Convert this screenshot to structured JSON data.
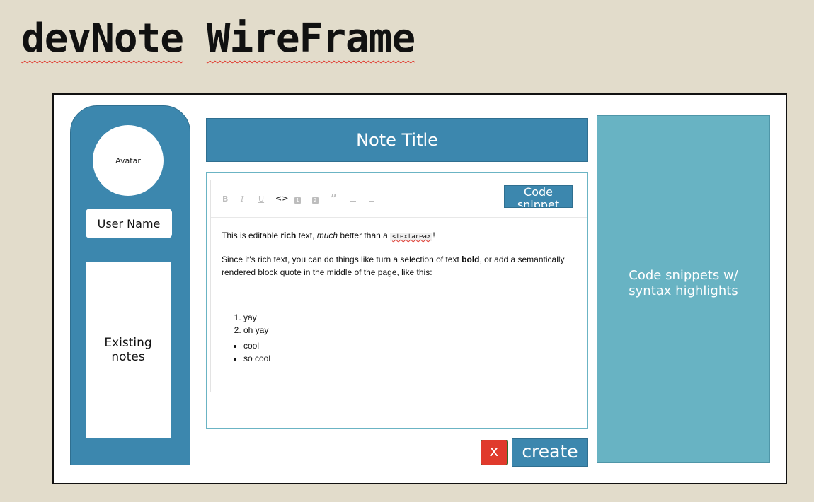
{
  "page": {
    "title_part1": "devNote",
    "title_part2": "WireFrame"
  },
  "sidebar": {
    "avatar_label": "Avatar",
    "username": "User Name",
    "notes_label": "Existing\nnotes"
  },
  "main": {
    "note_title": "Note Title",
    "code_snippet_button": "Code snippet",
    "toolbar": {
      "bold": "B",
      "italic": "I",
      "underline": "U",
      "code": "<>",
      "heading1": "1",
      "heading2": "2",
      "quote": "”"
    },
    "editor": {
      "p1_a": "This is editable ",
      "p1_b": "rich",
      "p1_c": " text, ",
      "p1_d": "much",
      "p1_e": " better than a ",
      "p1_code": "<textarea>",
      "p1_f": "!",
      "p2_a": "Since it's rich text, you can do things like turn a selection of text ",
      "p2_b": "bold",
      "p2_c": ", or add a semantically rendered block quote in the middle of the page, like this:",
      "ordered": [
        "yay",
        "oh yay"
      ],
      "bulleted": [
        "cool",
        "so cool"
      ]
    },
    "cancel_button": "x",
    "create_button": "create"
  },
  "right_panel": {
    "label": "Code snippets w/\nsyntax highlights"
  },
  "colors": {
    "background": "#e2dccb",
    "primary_blue": "#3c87ae",
    "teal_panel": "#68b3c3",
    "cancel_red": "#e03a2c"
  }
}
